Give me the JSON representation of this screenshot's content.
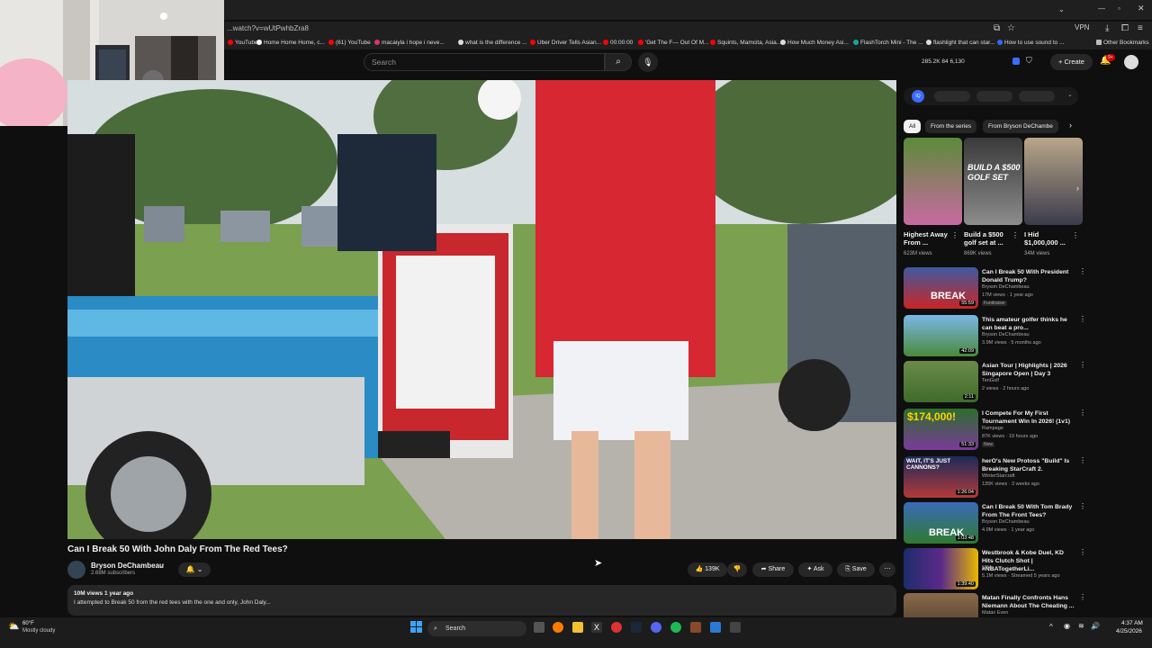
{
  "browser": {
    "url": "...watch?v=wUtPwhbZra8",
    "bookmarks": [
      "YouTube",
      "Home Home Home, c...",
      "(61) YouTube",
      "macaiyla i hope i neve...",
      "what is the difference ...",
      "Uber Driver Tells Asian...",
      "00:00:00",
      "'Get The F— Out Of M...",
      "Squints, Mamcita, Asia...",
      "How Much Money Asi...",
      "FlashTorch Mini - The ...",
      "flashlight that can star...",
      "How to use sound to ...",
      "Other Bookmarks"
    ],
    "vpn_label": "VPN"
  },
  "header": {
    "search_placeholder": "Search",
    "ext_stats": "285.2K   84   6,130",
    "create_label": "Create",
    "notif_count": "9+"
  },
  "video": {
    "title": "Can I Break 50 With John Daly From The Red Tees?",
    "channel": "Bryson DeChambeau",
    "subscribers": "2.68M subscribers",
    "likes": "139K",
    "share_label": "Share",
    "ask_label": "Ask",
    "save_label": "Save",
    "views_date": "10M views  1 year ago",
    "description": "I attempted to Break 50 from the red tees with the one and only, John Daly..."
  },
  "sidebar": {
    "chips": [
      "All",
      "From the series",
      "From Bryson DeChambe"
    ],
    "shorts": [
      {
        "title": "Highest Away From ...",
        "views": "623M views"
      },
      {
        "title": "Build a $500 golf set at ...",
        "views": "869K views"
      },
      {
        "title": "I Hid $1,000,000 ...",
        "views": "34M views"
      }
    ],
    "recommendations": [
      {
        "title": "Can I Break 50 With President Donald Trump?",
        "channel": "Bryson DeChambeau",
        "meta": "17M views · 1 year ago",
        "badge": "Fundraiser",
        "duration": "55:59"
      },
      {
        "title": "This amateur golfer thinks he can beat a pro...",
        "channel": "Bryson DeChambeau",
        "meta": "3.9M views · 5 months ago",
        "badge": "",
        "duration": "42:09"
      },
      {
        "title": "Asian Tour | Highlights | 2026 Singapore Open | Day 3",
        "channel": "TenGolf",
        "meta": "2 views · 2 hours ago",
        "badge": "",
        "duration": "2:11"
      },
      {
        "title": "I Compete For My First Tournament Win In 2026! (1v1)",
        "channel": "Rampage",
        "meta": "87K views · 19 hours ago",
        "badge": "New",
        "duration": "51:33"
      },
      {
        "title": "herO's New Protoss \"Build\" Is Breaking StarCraft 2.",
        "channel": "WinterStarcraft",
        "meta": "135K views · 3 weeks ago",
        "badge": "",
        "duration": "1:26:04"
      },
      {
        "title": "Can I Break 50 With Tom Brady From The Front Tees?",
        "channel": "Bryson DeChambeau",
        "meta": "4.9M views · 1 year ago",
        "badge": "",
        "duration": "1:03:48"
      },
      {
        "title": "Westbrook & Kobe Duel, KD Hits Clutch Shot | #NBATogetherLi...",
        "channel": "NBA",
        "meta": "5.1M views · Streamed 5 years ago",
        "badge": "",
        "duration": "1:39:40"
      },
      {
        "title": "Matan Finally Confronts Hans Niemann About The Cheating ...",
        "channel": "Matan Even",
        "meta": "",
        "badge": "",
        "duration": ""
      }
    ]
  },
  "taskbar": {
    "temp": "60°F",
    "condition": "Mostly cloudy",
    "search_label": "Search",
    "time": "4:37 AM",
    "date": "4/25/2026"
  }
}
